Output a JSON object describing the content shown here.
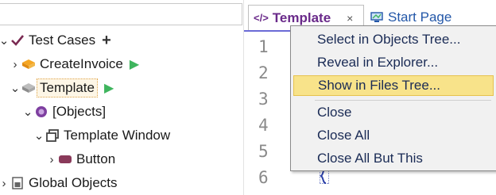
{
  "tree": {
    "items": [
      {
        "label": "Test Cases"
      },
      {
        "label": "CreateInvoice"
      },
      {
        "label": "Template"
      },
      {
        "label": "[Objects]"
      },
      {
        "label": "Template Window"
      },
      {
        "label": "Button"
      },
      {
        "label": "Global Objects"
      }
    ]
  },
  "tabs": [
    {
      "label": "Template",
      "close": "×"
    },
    {
      "label": "Start Page"
    }
  ],
  "editor": {
    "line_numbers": [
      "1",
      "2",
      "3",
      "4",
      "5",
      "6"
    ]
  },
  "context_menu": {
    "items": [
      {
        "label": "Select in Objects Tree..."
      },
      {
        "label": "Reveal in Explorer..."
      },
      {
        "label": "Show in Files Tree..."
      },
      {
        "label": "Close"
      },
      {
        "label": "Close All"
      },
      {
        "label": "Close All But This"
      }
    ],
    "highlighted_index": 2
  },
  "colors": {
    "highlight": "#f8e38a",
    "play": "#3fb55e",
    "active_tab_text": "#6a2a8a",
    "link_tab_text": "#2357a8"
  }
}
